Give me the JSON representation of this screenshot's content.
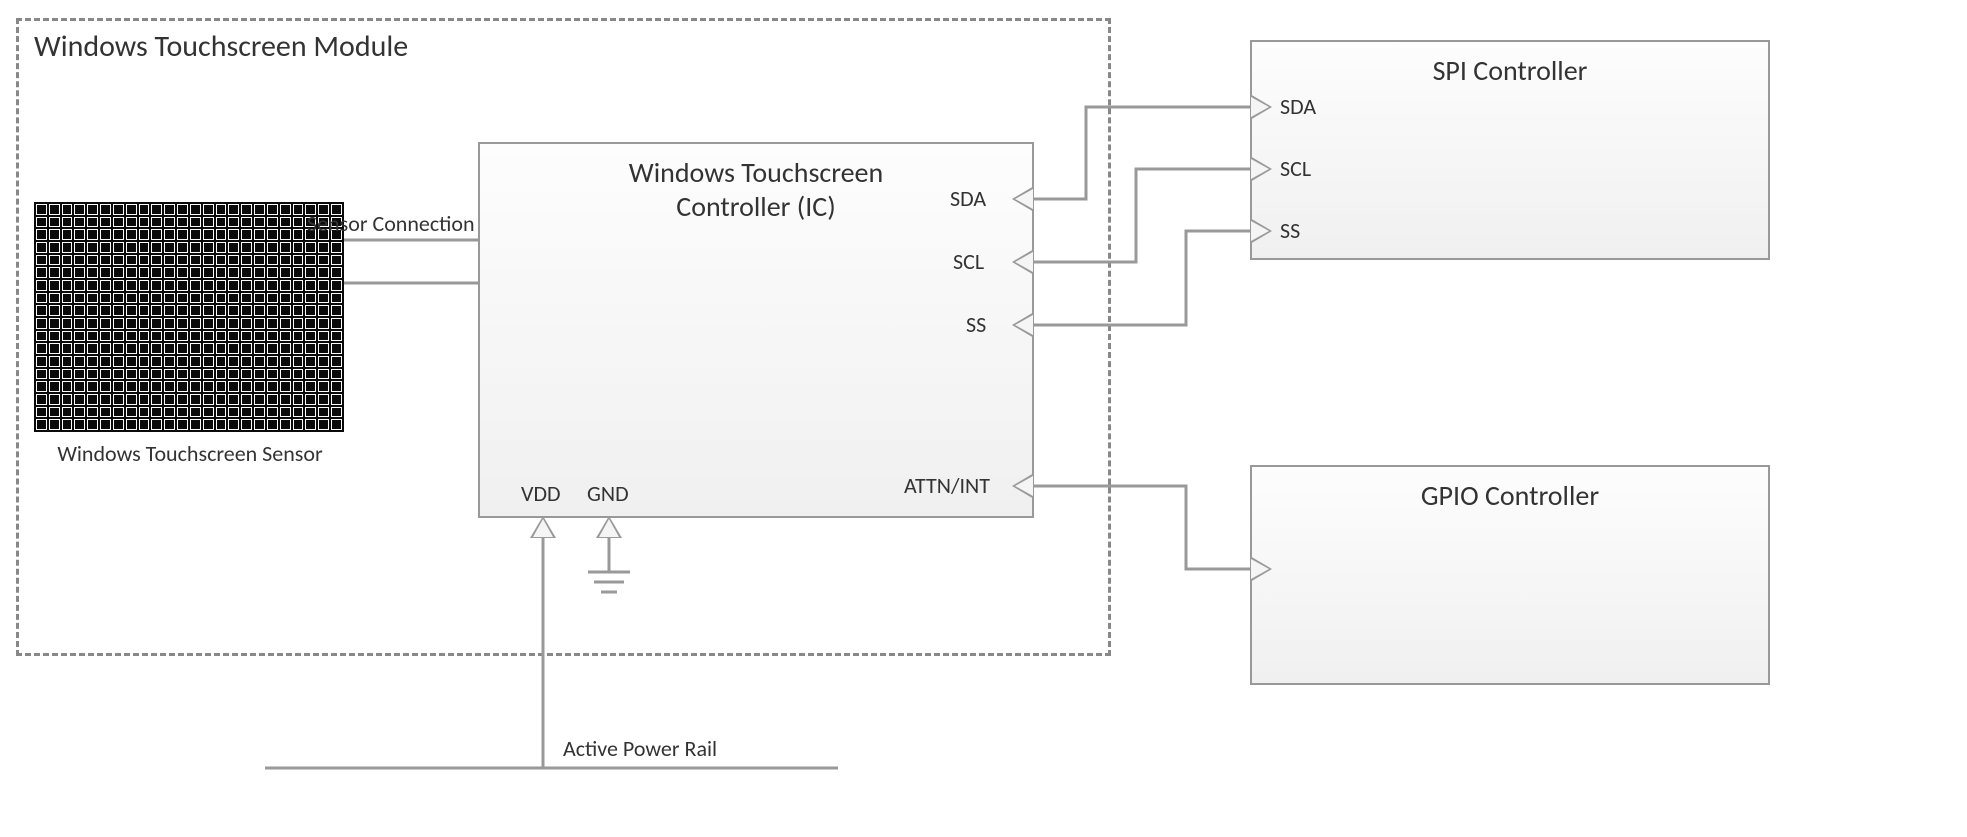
{
  "module": {
    "title": "Windows Touchscreen Module"
  },
  "sensor": {
    "caption": "Windows Touchscreen Sensor",
    "connection_label": "Sensor Connection"
  },
  "controller": {
    "title_line1": "Windows Touchscreen",
    "title_line2": "Controller (IC)",
    "pins": {
      "vdd": "VDD",
      "gnd": "GND",
      "sda": "SDA",
      "scl": "SCL",
      "ss": "SS",
      "attn": "ATTN/INT"
    }
  },
  "spi": {
    "title": "SPI Controller",
    "pins": {
      "sda": "SDA",
      "scl": "SCL",
      "ss": "SS"
    }
  },
  "gpio": {
    "title": "GPIO Controller"
  },
  "power": {
    "label": "Active Power Rail"
  }
}
